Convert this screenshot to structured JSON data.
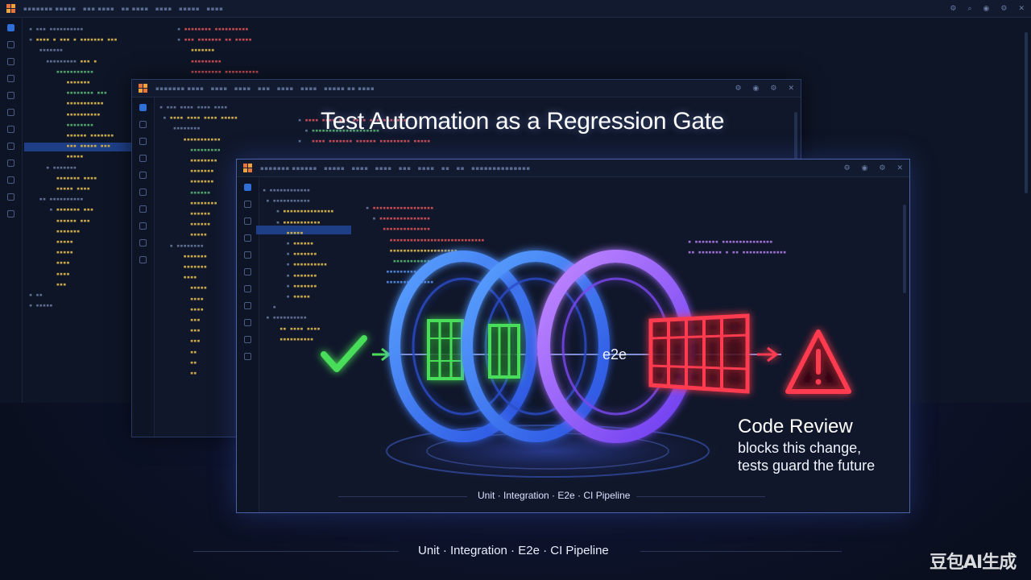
{
  "headline": "Test Automation as a Regression Gate",
  "ring_label": "e2e",
  "review": {
    "title": "Code Review",
    "line1": "blocks this change,",
    "line2": "tests guard the future"
  },
  "inner_caption": "Unit · Integration · E2e · CI Pipeline",
  "bottom_caption": "Unit  ·  Integration  ·  E2e  ·  CI Pipeline",
  "watermark": "豆包AI生成",
  "icons": {
    "pass": "check-icon",
    "fail": "warning-icon",
    "gate_open": "green-gate-icon",
    "gate_closed": "red-gate-icon"
  },
  "colors": {
    "pass_green": "#4ade5a",
    "fail_red": "#ff3b4f",
    "ring_blue": "#3b82ff",
    "ring_purple": "#a855f7"
  }
}
